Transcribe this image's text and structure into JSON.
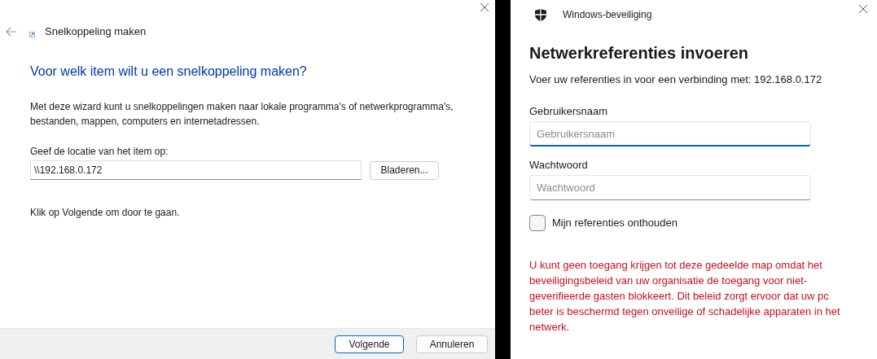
{
  "wizard": {
    "title": "Snelkoppeling maken",
    "heading": "Voor welk item wilt u een snelkoppeling maken?",
    "description": "Met deze wizard kunt u snelkoppelingen maken naar lokale programma's of netwerkprogramma's, bestanden, mappen, computers en internetadressen.",
    "location_label": "Geef de locatie van het item op:",
    "location_value": "\\\\192.168.0.172",
    "browse_button": "Bladeren...",
    "hint": "Klik op Volgende om door te gaan.",
    "buttons": [
      {
        "label": "Volgende",
        "selected": true
      },
      {
        "label": "Annuleren",
        "selected": false
      }
    ]
  },
  "security_dialog": {
    "title": "Windows-beveiliging",
    "heading": "Netwerkreferenties invoeren",
    "subtitle": "Voer uw referenties in voor een verbinding met: 192.168.0.172",
    "fields": [
      {
        "label": "Gebruikersnaam",
        "placeholder": "Gebruikersnaam",
        "focused": true
      },
      {
        "label": "Wachtwoord",
        "placeholder": "Wachtwoord",
        "focused": false
      }
    ],
    "remember": {
      "label": "Mijn referenties onthouden",
      "checked": false
    },
    "error": "U kunt geen toegang krijgen tot deze gedeelde map omdat het beveiligingsbeleid van uw organisatie de toegang voor niet-geverifieerde gasten blokkeert. Dit beleid zorgt ervoor dat uw pc beter is beschermd tegen onveilige of schadelijke apparaten in het netwerk."
  }
}
